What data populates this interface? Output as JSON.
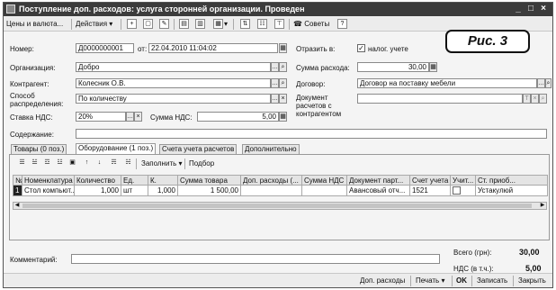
{
  "window": {
    "title": "Поступление доп. расходов: услуга сторонней организации. Проведен",
    "buttons": {
      "minimize": "_",
      "maximize": "□",
      "close": "×"
    }
  },
  "callout": {
    "text": "Рис. 3"
  },
  "toolbar": {
    "prices_label": "Цены и валюта...",
    "actions_label": "Действия",
    "dropdown_arrow": "▾",
    "advice_label": "Советы",
    "help_label": "?"
  },
  "form": {
    "number_label": "Номер:",
    "number_value": "Д0000000001",
    "date_label": "от:",
    "date_value": "22.04.2010 11:04:02",
    "organization_label": "Организация:",
    "organization_value": "Добро",
    "counterparty_label": "Контрагент:",
    "counterparty_value": "Колесник О.В.",
    "distribution_label_1": "Способ",
    "distribution_label_2": "распределения:",
    "distribution_value": "По количеству",
    "vat_rate_label": "Ставка НДС:",
    "vat_rate_value": "20%",
    "vat_sum_label": "Сумма НДС:",
    "vat_sum_value": "5,00",
    "reflect_label": "Отразить в:",
    "tax_accounting_label": "налог. учете",
    "tax_accounting_checked": "✓",
    "expense_sum_label": "Сумма расхода:",
    "expense_sum_value": "30,00",
    "contract_label": "Договор:",
    "contract_value": "Договор на поставку мебели",
    "settlement_doc_label_1": "Документ",
    "settlement_doc_label_2": "расчетов с",
    "settlement_doc_label_3": "контрагентом",
    "settlement_doc_value": "",
    "content_label": "Содержание:",
    "content_value": ""
  },
  "tabs": [
    {
      "label": "Товары (0 поз.)"
    },
    {
      "label": "Оборудование (1 поз.)"
    },
    {
      "label": "Счета учета расчетов"
    },
    {
      "label": "Дополнительно"
    }
  ],
  "table_toolbar": {
    "fill_label": "Заполнить",
    "select_label": "Подбор"
  },
  "table": {
    "headers": [
      "№",
      "Номенклатура",
      "Количество",
      "Ед.",
      "К.",
      "Сумма товара",
      "Доп. расходы (...",
      "Сумма НДС",
      "Документ парт...",
      "Счет учета",
      "Учит...",
      "Ст. приоб..."
    ],
    "rows": [
      [
        "1",
        "Стол компьют...",
        "1,000",
        "шт",
        "1,000",
        "1 500,00",
        "",
        "",
        "Авансовый отч...",
        "1521",
        "",
        "Устакулюй"
      ]
    ]
  },
  "totals": {
    "total_label": "Всего (грн):",
    "total_value": "30,00",
    "vat_label": "НДС (в т.ч.):",
    "vat_value": "5,00"
  },
  "comment": {
    "label": "Комментарий:",
    "value": ""
  },
  "bottom": {
    "extra_expenses": "Доп. расходы",
    "print": "Печать",
    "ok": "OK",
    "save": "Записать",
    "close": "Закрыть"
  }
}
